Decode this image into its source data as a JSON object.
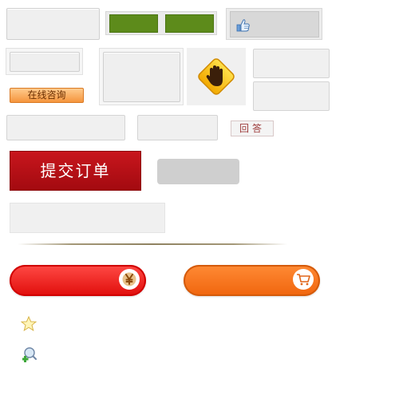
{
  "buttons": {
    "consult_label": "在线咨询",
    "reply_label": "回答",
    "submit_label": "提交订单"
  },
  "icons": {
    "thumbs": "thumbs-up-icon",
    "stop": "stop-hand-icon",
    "yen": "yen-icon",
    "cart": "cart-icon",
    "star": "star-icon",
    "zoom": "zoom-add-icon"
  },
  "colors": {
    "green": "#5d8b1b",
    "submit_red": "#b30f14",
    "pill_red": "#f01a17",
    "pill_orange": "#f3741b",
    "consult_orange": "#f5953d"
  }
}
